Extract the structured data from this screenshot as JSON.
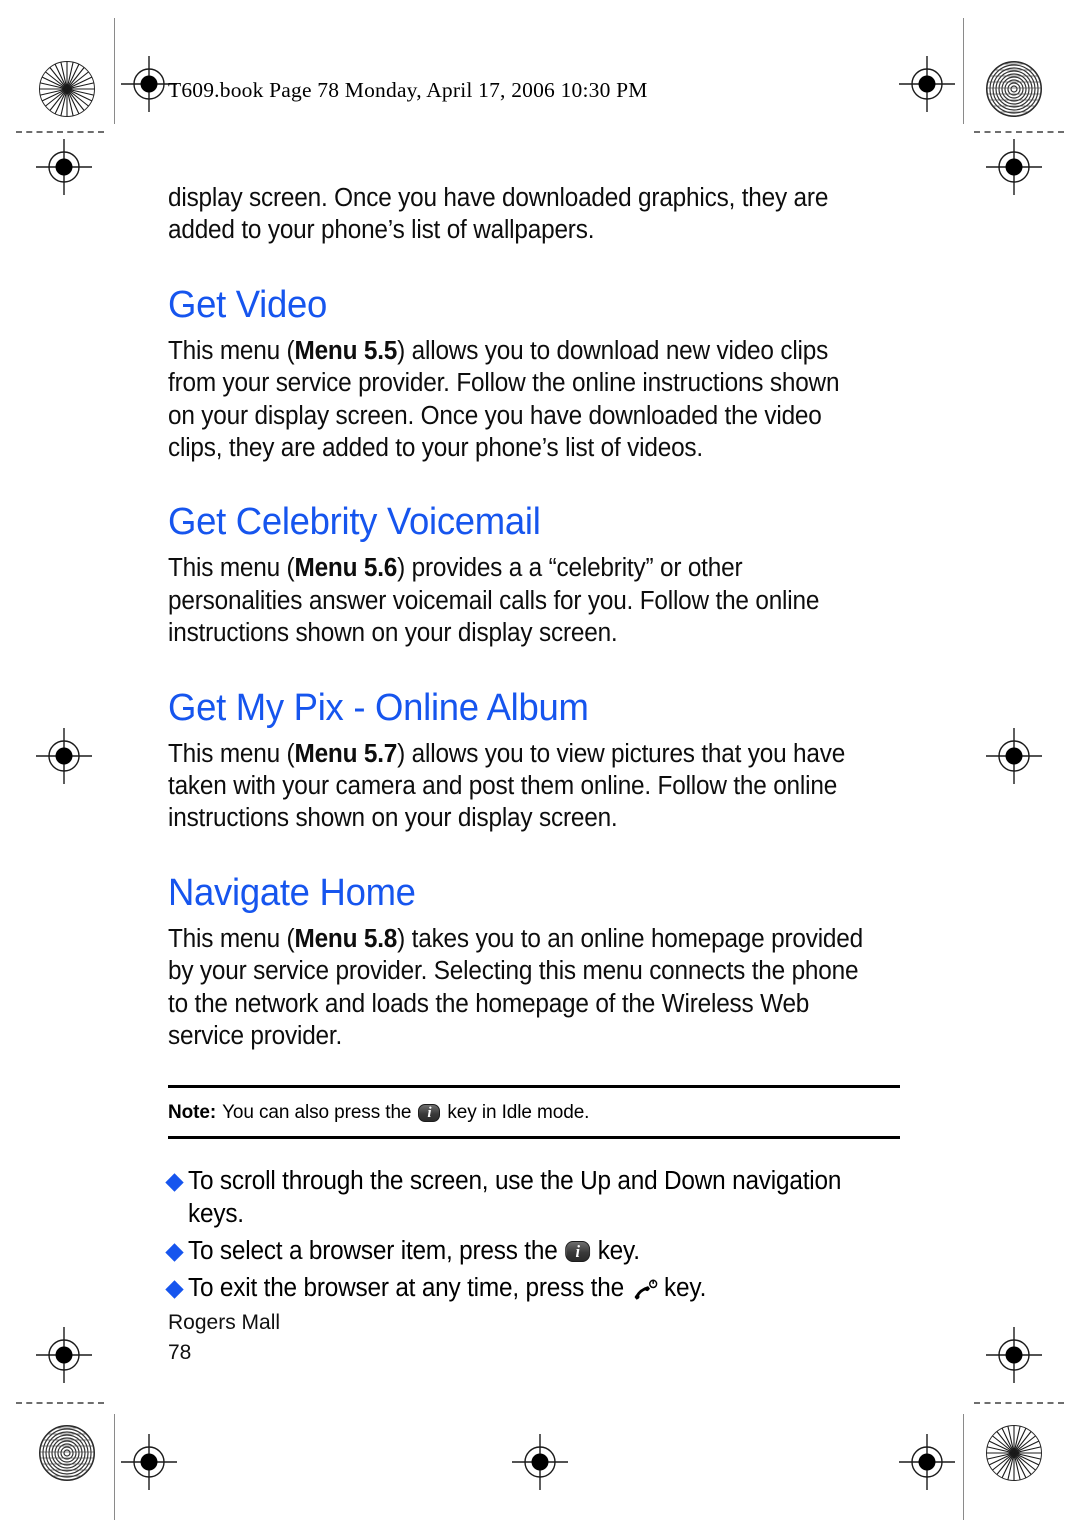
{
  "document": {
    "header": "T609.book  Page 78  Monday, April 17, 2006  10:30 PM",
    "page_number": "78",
    "footer_label": "Rogers Mall"
  },
  "body": {
    "intro_paragraph": "display screen. Once you have downloaded graphics, they are added to your phone’s list of wallpapers.",
    "sections": [
      {
        "heading": "Get Video",
        "menu_ref": "Menu 5.5",
        "text_before": "This menu (",
        "text_after": ") allows you to download new video clips from your service provider. Follow the online instructions shown on your display screen. Once you have downloaded the video clips, they are added to your phone’s list of videos."
      },
      {
        "heading": "Get Celebrity Voicemail",
        "menu_ref": "Menu 5.6",
        "text_before": "This menu (",
        "text_after": ") provides a a “celebrity” or other personalities answer voicemail calls for you. Follow the online instructions shown on your display screen."
      },
      {
        "heading": "Get My Pix - Online Album",
        "menu_ref": "Menu 5.7",
        "text_before": "This menu (",
        "text_after": ") allows you to view pictures that you have taken with your camera and post them online. Follow the online instructions shown on your display screen."
      },
      {
        "heading": "Navigate Home",
        "menu_ref": "Menu 5.8",
        "text_before": "This menu (",
        "text_after": ") takes you to an online homepage provided by your service provider. Selecting this menu connects the phone to the network and loads the homepage of the Wireless Web service provider."
      }
    ]
  },
  "note": {
    "label": "Note:",
    "text_before": "You can also press the",
    "icon": "info-key-icon",
    "text_after": "key in Idle mode."
  },
  "bullets": [
    {
      "text_before": "To scroll through the screen, use the Up and Down navigation keys.",
      "icon": null,
      "text_after": ""
    },
    {
      "text_before": "To select a browser item, press the",
      "icon": "info-key-icon",
      "text_after": "key."
    },
    {
      "text_before": "To exit the browser at any time, press the",
      "icon": "end-call-key-icon",
      "text_after": "key."
    }
  ],
  "colors": {
    "heading_blue": "#1655ee",
    "bullet_blue": "#1655ee",
    "text_black": "#0d0d0d"
  }
}
